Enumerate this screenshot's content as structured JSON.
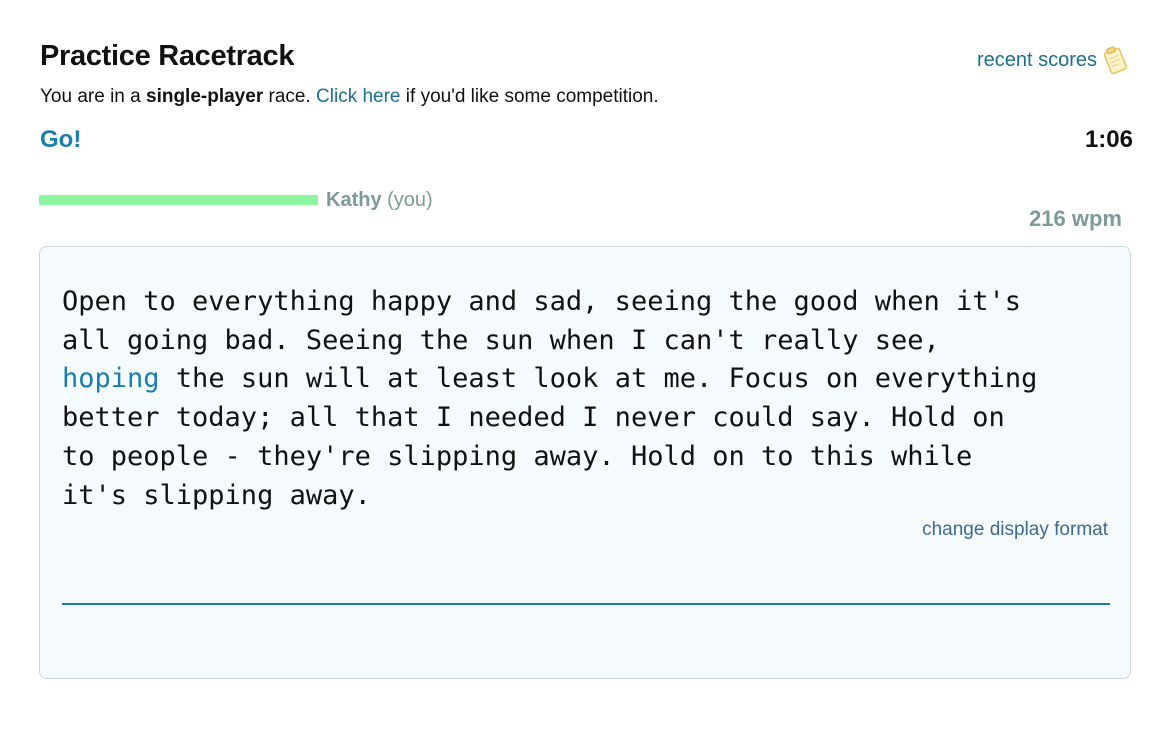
{
  "header": {
    "title": "Practice Racetrack",
    "recent_scores_label": "recent scores",
    "recent_scores_icon": "clipboard-icon"
  },
  "subtitle": {
    "prefix": "You are in a ",
    "mode": "single-player",
    "mid": " race. ",
    "link": "Click here",
    "suffix": " if you'd like some competition."
  },
  "status": {
    "go_label": "Go!",
    "timer": "1:06"
  },
  "racer": {
    "name": "Kathy",
    "you_tag": "(you)",
    "wpm": "216 wpm",
    "progress_fraction": 0.26,
    "bar_color": "#8cf5a0"
  },
  "passage": {
    "typed": "Open to everything happy and sad, seeing the good when it's\nall going bad. Seeing the sun when I can't really see,\n",
    "current_word": "hoping",
    "remaining": " the sun will at least look at me. Focus on everything\nbetter today; all that I needed I never could say. Hold on\nto people - they're slipping away. Hold on to this while\nit's slipping away."
  },
  "change_format_label": "change display format",
  "input": {
    "value": "",
    "placeholder": ""
  },
  "colors": {
    "accent": "#1a7fb0",
    "link": "#1a6f8e",
    "muted": "#7b9a98",
    "panel_bg": "#f5fafd"
  }
}
